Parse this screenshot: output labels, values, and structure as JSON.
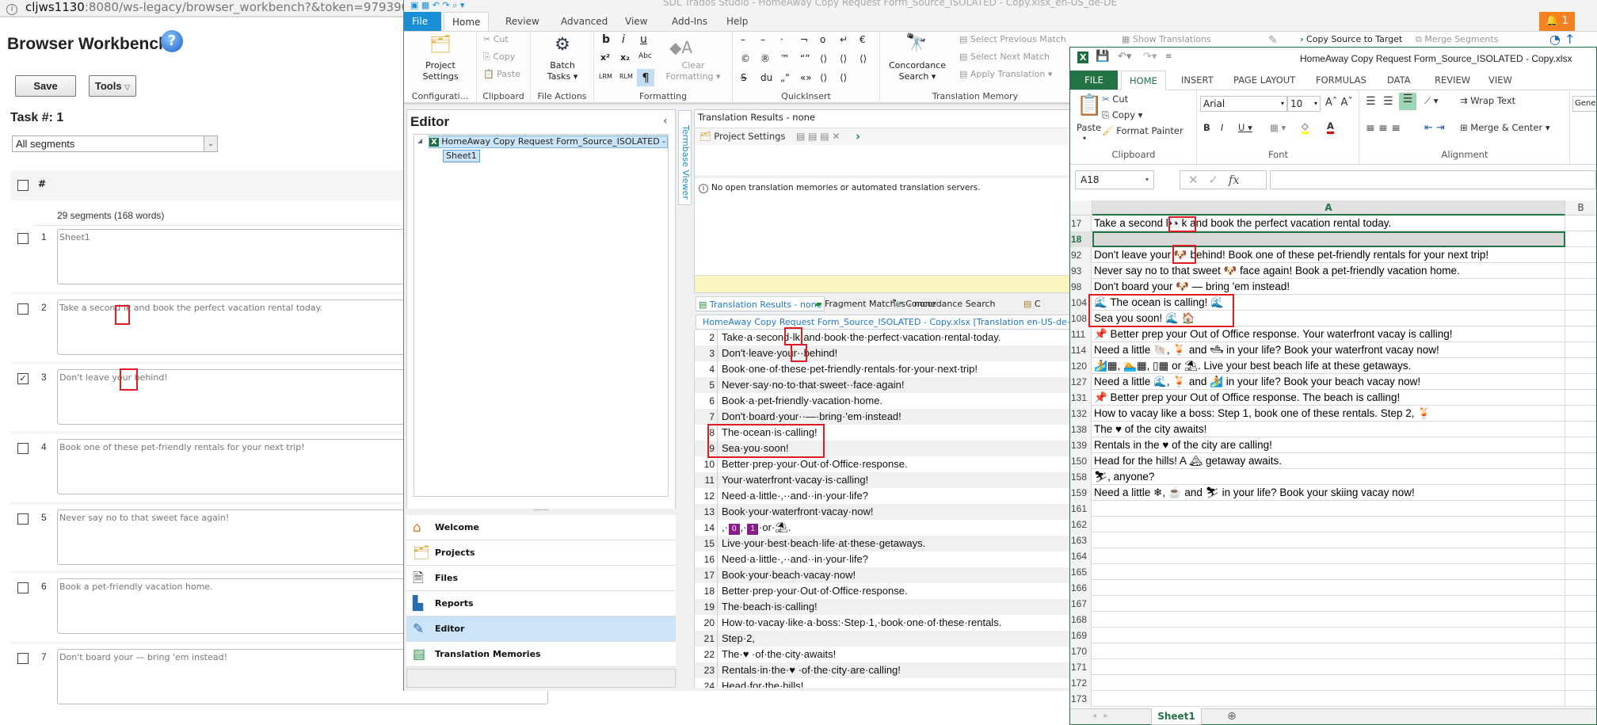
{
  "browser": {
    "url_host": "cljws1130",
    "url_path": ":8080/ws-legacy/browser_workbench?&token=979390323&mode="
  },
  "workbench": {
    "title": "Browser Workbench",
    "help_icon": "help-icon",
    "save_label": "Save",
    "tools_label": "Tools",
    "task_label": "Task #: 1",
    "filter_value": "All segments",
    "header_hash": "#",
    "segment_count": "29 segments (168 words)",
    "segments": [
      {
        "num": "1",
        "text": "Sheet1",
        "checked": false
      },
      {
        "num": "2",
        "text": "Take a second lk and book the perfect vacation rental today.",
        "checked": false
      },
      {
        "num": "3",
        "text": "Don't leave your  behind!",
        "checked": true
      },
      {
        "num": "4",
        "text": "Book one of these pet-friendly rentals for your next trip!",
        "checked": false
      },
      {
        "num": "5",
        "text": "Never say no to that sweet  face again!",
        "checked": false
      },
      {
        "num": "6",
        "text": "Book a pet-friendly vacation home.",
        "checked": false
      },
      {
        "num": "7",
        "text": "Don't board your  — bring 'em instead!",
        "checked": false
      }
    ]
  },
  "trados": {
    "title": "SDL Trados Studio - HomeAway Copy Request Form_Source_ISOLATED - Copy.xlsx_en-US_de-DE",
    "notification_count": "1",
    "tabs": [
      "File",
      "Home",
      "Review",
      "Advanced",
      "View",
      "Add-Ins",
      "Help"
    ],
    "active_tab": "Home",
    "ribbon": {
      "configuration": {
        "label": "Configurati...",
        "project_settings": "Project Settings"
      },
      "clipboard": {
        "label": "Clipboard",
        "cut": "Cut",
        "copy": "Copy",
        "paste": "Paste"
      },
      "file_actions": {
        "label": "File Actions",
        "batch_tasks": "Batch Tasks ▾"
      },
      "formatting": {
        "label": "Formatting",
        "bold": "b",
        "italic": "i",
        "underline": "u",
        "superscript": "x²",
        "subscript": "x₂",
        "small_caps": "Abc",
        "lrm": "LRM",
        "rlm": "RLM",
        "pilcrow": "¶",
        "clear_formatting": "Clear Formatting ▾"
      },
      "quickinsert": {
        "label": "QuickInsert",
        "row1": [
          "–",
          "–",
          "·",
          "¬",
          "o",
          "↵",
          "€"
        ],
        "row2": [
          "©",
          "®",
          "™",
          "“”",
          "⟨⟩",
          "⟨⟩",
          "⟨⟩"
        ],
        "row3": [
          "S̶",
          "du",
          "„\"",
          "«»",
          "⟨⟩",
          "⟨⟩"
        ]
      },
      "translation_memory": {
        "label": "Translation Memory",
        "concordance_search": "Concordance Search ▾",
        "select_previous_match": "Select Previous Match",
        "select_next_match": "Select Next Match",
        "apply_translation": "Apply Translation ▾"
      },
      "show_translations": "Show Translations",
      "copy_source_to_target": "Copy Source to Target",
      "merge_segments": "Merge Segments"
    },
    "editor": {
      "heading": "Editor",
      "tree_file": "HomeAway Copy Request Form_Source_ISOLATED -",
      "tree_sheet": "Sheet1"
    },
    "nav": [
      {
        "label": "Welcome",
        "icon": "home-icon"
      },
      {
        "label": "Projects",
        "icon": "folder-icon"
      },
      {
        "label": "Files",
        "icon": "file-icon"
      },
      {
        "label": "Reports",
        "icon": "report-icon"
      },
      {
        "label": "Editor",
        "icon": "pencil-icon",
        "active": true
      },
      {
        "label": "Translation Memories",
        "icon": "tm-icon"
      }
    ],
    "termbase_viewer": "Termbase Viewer",
    "translation_results": {
      "header": "Translation Results - none",
      "project_settings": "Project Settings",
      "message": "No open translation memories or automated translation servers."
    },
    "bottom_tabs": [
      "Translation Results - none",
      "Fragment Matches - none",
      "Concordance Search",
      "C"
    ],
    "document_header": "HomeAway Copy Request Form_Source_ISOLATED - Copy.xlsx [Translation en-US-de-DE]",
    "segments": [
      {
        "num": "2",
        "parts": [
          {
            "t": "Take·a·second·lk·and·book·the·perfect·vacation·rental·today."
          }
        ]
      },
      {
        "num": "3",
        "parts": [
          {
            "t": "Don't·leave·your··behind!"
          }
        ]
      },
      {
        "num": "4",
        "parts": [
          {
            "t": "Book·one·of·these·pet-friendly·rentals·for·your·next·trip!"
          }
        ]
      },
      {
        "num": "5",
        "parts": [
          {
            "t": "Never·say·no·to·that·sweet··face·again!"
          }
        ]
      },
      {
        "num": "6",
        "parts": [
          {
            "t": "Book·a·pet-friendly·vacation·home."
          }
        ]
      },
      {
        "num": "7",
        "parts": [
          {
            "t": "Don't·board·your··—·bring·'em·instead!"
          }
        ]
      },
      {
        "num": "8",
        "parts": [
          {
            "t": "The·ocean·is·calling!"
          }
        ]
      },
      {
        "num": "9",
        "parts": [
          {
            "t": "Sea·you·soon!"
          }
        ]
      },
      {
        "num": "10",
        "parts": [
          {
            "t": "Better·prep·your·Out·of·Office·response."
          }
        ]
      },
      {
        "num": "11",
        "parts": [
          {
            "t": "Your·waterfront·vacay·is·calling!"
          }
        ]
      },
      {
        "num": "12",
        "parts": [
          {
            "t": "Need·a·little·,··and··in·your·life?"
          }
        ]
      },
      {
        "num": "13",
        "parts": [
          {
            "t": "Book·your·waterfront·vacay·now!"
          }
        ]
      },
      {
        "num": "14",
        "parts": [
          {
            "t": ",·"
          },
          {
            "t": "0",
            "tag": true
          },
          {
            "t": ",·"
          },
          {
            "t": "1",
            "tag": true
          },
          {
            "t": "·or·⛱."
          }
        ]
      },
      {
        "num": "15",
        "parts": [
          {
            "t": "Live·your·best·beach·life·at·these·getaways."
          }
        ]
      },
      {
        "num": "16",
        "parts": [
          {
            "t": "Need·a·little·,··and··in·your·life?"
          }
        ]
      },
      {
        "num": "17",
        "parts": [
          {
            "t": "Book·your·beach·vacay·now!"
          }
        ]
      },
      {
        "num": "18",
        "parts": [
          {
            "t": "Better·prep·your·Out·of·Office·response."
          }
        ]
      },
      {
        "num": "19",
        "parts": [
          {
            "t": "The·beach·is·calling!"
          }
        ]
      },
      {
        "num": "20",
        "parts": [
          {
            "t": "How·to·vacay·like·a·boss:·Step·1,·book·one·of·these·rentals."
          }
        ]
      },
      {
        "num": "21",
        "parts": [
          {
            "t": "Step·2,"
          }
        ]
      },
      {
        "num": "22",
        "parts": [
          {
            "t": "The·♥      ·of·the·city·awaits!"
          }
        ]
      },
      {
        "num": "23",
        "parts": [
          {
            "t": "Rentals·in·the·♥      ·of·the·city·are·calling!"
          }
        ]
      },
      {
        "num": "24",
        "parts": [
          {
            "t": "Head·for·the·hills!"
          }
        ]
      }
    ]
  },
  "excel": {
    "title": "HomeAway Copy Request Form_Source_ISOLATED - Copy.xlsx",
    "tabs": [
      "FILE",
      "HOME",
      "INSERT",
      "PAGE LAYOUT",
      "FORMULAS",
      "DATA",
      "REVIEW",
      "VIEW"
    ],
    "active_tab": "HOME",
    "ribbon": {
      "clipboard": {
        "label": "Clipboard",
        "paste": "Paste",
        "cut": "Cut",
        "copy": "Copy",
        "format_painter": "Format Painter"
      },
      "font": {
        "label": "Font",
        "name": "Arial",
        "size": "10"
      },
      "alignment": {
        "label": "Alignment",
        "wrap_text": "Wrap Text",
        "merge_center": "Merge & Center"
      },
      "number": {
        "format": "Gene"
      }
    },
    "name_box": "A18",
    "formula": "",
    "columns": [
      "A",
      "B"
    ],
    "rows": [
      {
        "row": "17",
        "text": "Take a second l👀k and book the perfect vacation rental today."
      },
      {
        "row": "18",
        "text": "",
        "selected": true
      },
      {
        "row": "92",
        "text": "Don't leave your 🐶 behind! Book one of these pet-friendly rentals for your next trip!"
      },
      {
        "row": "93",
        "text": "Never say no to that sweet 🐶 face again! Book a pet-friendly vacation home."
      },
      {
        "row": "98",
        "text": "Don't board your 🐶 — bring 'em instead!"
      },
      {
        "row": "104",
        "text": "🌊 The ocean is calling! 🌊"
      },
      {
        "row": "108",
        "text": "Sea you soon! 🌊 🏠"
      },
      {
        "row": "111",
        "text": "📌 Better prep your Out of Office response. Your waterfront vacay is calling!"
      },
      {
        "row": "114",
        "text": "Need a little 🐚, 🍹 and 🛥 in your life? Book your waterfront vacay now!"
      },
      {
        "row": "120",
        "text": "🏄▦, 🏊▦, ▯▦ or ⛱. Live your best beach life at these getaways."
      },
      {
        "row": "127",
        "text": "Need a little 🌊, 🍹 and 🏄 in your life? Book your beach vacay now!"
      },
      {
        "row": "131",
        "text": "📌 Better prep your Out of Office response. The beach is calling!"
      },
      {
        "row": "132",
        "text": "How to vacay like a boss: Step 1, book one of these rentals. Step 2, 🍹"
      },
      {
        "row": "138",
        "text": "The ♥ of the city awaits!"
      },
      {
        "row": "139",
        "text": "Rentals in the ♥ of the city are calling!"
      },
      {
        "row": "150",
        "text": "Head for the hills! A 🏔 getaway awaits."
      },
      {
        "row": "158",
        "text": "⛷, anyone?"
      },
      {
        "row": "159",
        "text": "Need a little ❄, ☕ and ⛷ in your life? Book your skiing vacay now!"
      },
      {
        "row": "161",
        "text": ""
      },
      {
        "row": "162",
        "text": ""
      },
      {
        "row": "163",
        "text": ""
      },
      {
        "row": "164",
        "text": ""
      },
      {
        "row": "165",
        "text": ""
      },
      {
        "row": "166",
        "text": ""
      },
      {
        "row": "167",
        "text": ""
      },
      {
        "row": "168",
        "text": ""
      },
      {
        "row": "169",
        "text": ""
      },
      {
        "row": "170",
        "text": ""
      },
      {
        "row": "171",
        "text": ""
      },
      {
        "row": "172",
        "text": ""
      },
      {
        "row": "173",
        "text": ""
      }
    ],
    "sheet_tab": "Sheet1"
  },
  "colors": {
    "trados_file_tab": "#1a8fd6",
    "excel_green": "#217346",
    "highlight_red": "#e01b24",
    "tag_purple": "#8b1a8b",
    "notification_orange": "#f58220",
    "nav_selected": "#cce4f7"
  }
}
